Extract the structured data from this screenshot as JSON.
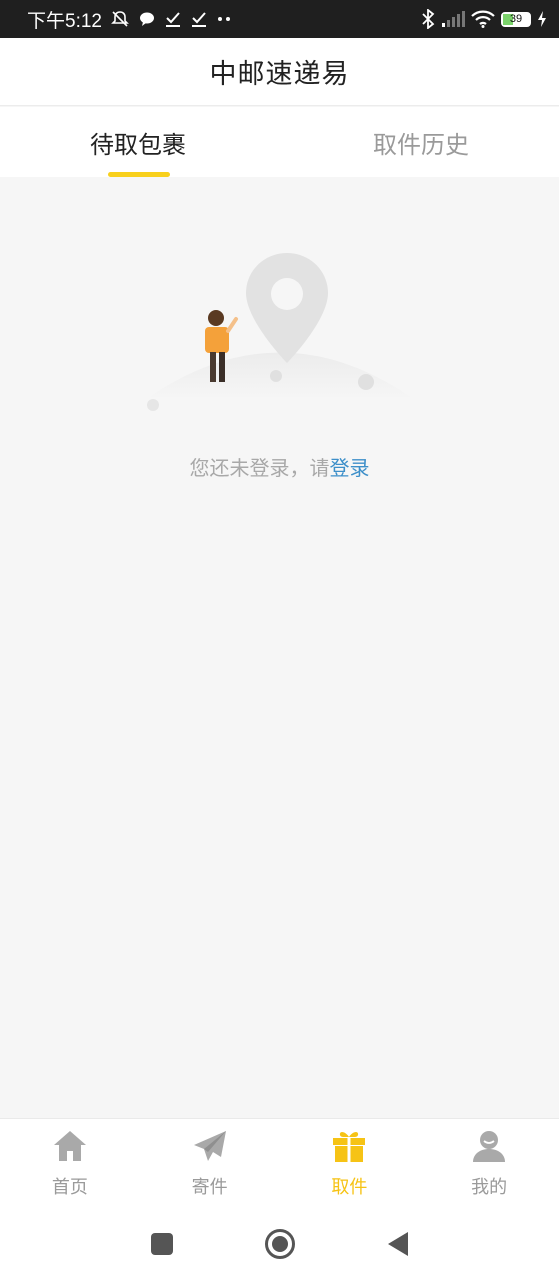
{
  "status_bar": {
    "time": "下午5:12",
    "battery_level": "39",
    "icons": [
      "mute-bell-icon",
      "chat-bubble-icon",
      "check-icon",
      "check-icon",
      "more-dots-icon",
      "bluetooth-icon",
      "signal-icon",
      "wifi-icon",
      "battery-icon",
      "charging-icon"
    ]
  },
  "header": {
    "title": "中邮速递易"
  },
  "tabs": [
    {
      "label": "待取包裹",
      "active": true
    },
    {
      "label": "取件历史",
      "active": false
    }
  ],
  "empty_state": {
    "message_prefix": "您还未登录，请",
    "login_link": "登录"
  },
  "bottom_nav": {
    "items": [
      {
        "label": "首页",
        "icon": "home-icon",
        "active": false
      },
      {
        "label": "寄件",
        "icon": "paper-plane-icon",
        "active": false
      },
      {
        "label": "取件",
        "icon": "gift-icon",
        "active": true
      },
      {
        "label": "我的",
        "icon": "user-icon",
        "active": false
      }
    ]
  },
  "colors": {
    "accent": "#f6c315",
    "indicator": "#f8d01c",
    "link": "#3d8fc9",
    "inactive": "#9a9a9a"
  }
}
